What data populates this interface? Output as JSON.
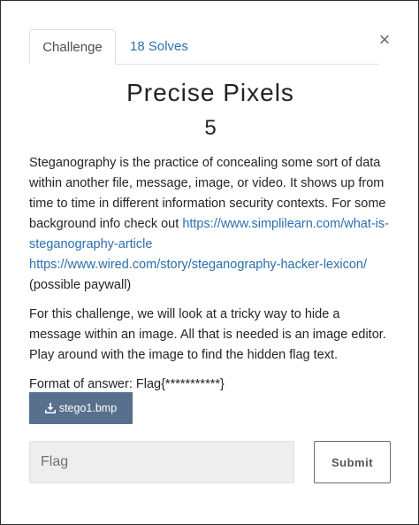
{
  "tabs": {
    "challenge_label": "Challenge",
    "solves_label": "18 Solves"
  },
  "close_icon": "×",
  "challenge": {
    "name": "Precise Pixels",
    "value": "5",
    "description": {
      "p1_text_a": "Steganography is the practice of concealing some sort of data within another file, message, image, or video. It shows up from time to time in different information security contexts. For some background info check out ",
      "link1": "https://www.simplilearn.com/what-is-steganography-article",
      "link2": "https://www.wired.com/story/steganography-hacker-lexicon/",
      "p1_text_b": " (possible paywall)",
      "p2": "For this challenge, we will look at a tricky way to hide a message within an image. All that is needed is an image editor. Play around with the image to find the hidden flag text.",
      "p3": "Format of answer: Flag{***********}"
    },
    "file_label": "stego1.bmp",
    "file_icon": "download-icon"
  },
  "answer": {
    "placeholder": "Flag",
    "submit_label": "Submit"
  },
  "colors": {
    "file_button": "#59708c",
    "link": "#2c6fad"
  }
}
